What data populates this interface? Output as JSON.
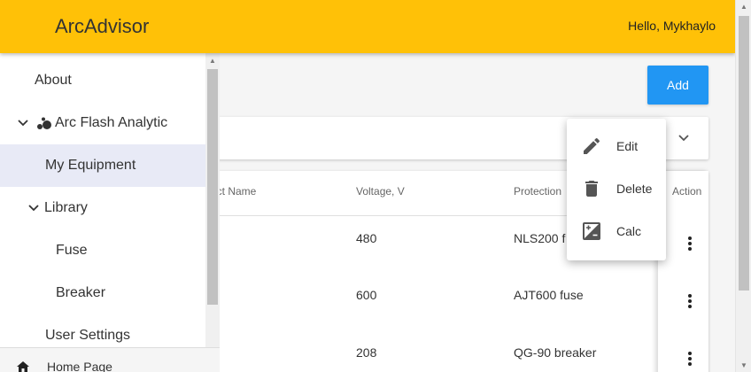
{
  "header": {
    "title": "ArcAdvisor",
    "greeting": "Hello, Mykhaylo"
  },
  "sidebar": {
    "items": [
      {
        "label": "About"
      },
      {
        "label": "Arc Flash Analytic"
      },
      {
        "label": "My Equipment"
      },
      {
        "label": "Library"
      },
      {
        "label": "Fuse"
      },
      {
        "label": "Breaker"
      },
      {
        "label": "User Settings"
      }
    ],
    "bottom": {
      "label": "Home Page"
    }
  },
  "toolbar": {
    "add_label": "Add"
  },
  "table": {
    "columns": [
      "ect Name",
      "Voltage, V",
      "Protection",
      "Action"
    ],
    "rows": [
      {
        "voltage": "480",
        "protection": "NLS200 f"
      },
      {
        "voltage": "600",
        "protection": "AJT600 fuse"
      },
      {
        "voltage": "208",
        "protection": "QG-90 breaker"
      }
    ]
  },
  "menu": {
    "items": [
      {
        "label": "Edit"
      },
      {
        "label": "Delete"
      },
      {
        "label": "Calc"
      }
    ]
  },
  "colors": {
    "header": "#ffc107",
    "accent": "#2196f3",
    "active_item": "#e8eaf6"
  }
}
